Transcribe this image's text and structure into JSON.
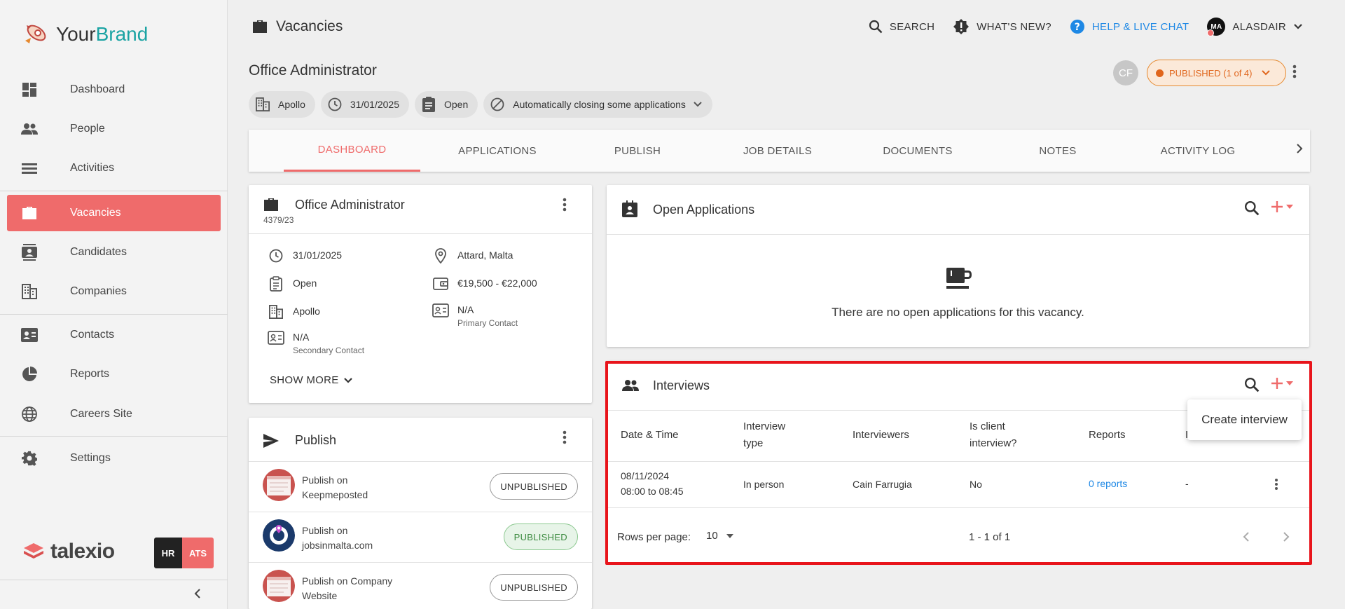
{
  "sidebar": {
    "brand": {
      "part1": "Your",
      "part2": "Brand"
    },
    "items": [
      {
        "label": "Dashboard",
        "icon": "dashboard-icon"
      },
      {
        "label": "People",
        "icon": "people-icon"
      },
      {
        "label": "Activities",
        "icon": "activities-icon"
      },
      {
        "label": "Vacancies",
        "icon": "briefcase-icon"
      },
      {
        "label": "Candidates",
        "icon": "candidates-icon"
      },
      {
        "label": "Companies",
        "icon": "building-icon"
      },
      {
        "label": "Contacts",
        "icon": "contact-card-icon"
      },
      {
        "label": "Reports",
        "icon": "pie-chart-icon"
      },
      {
        "label": "Careers Site",
        "icon": "globe-icon"
      },
      {
        "label": "Settings",
        "icon": "gear-icon"
      }
    ],
    "footer": {
      "logo_text": "talexio",
      "hr": "HR",
      "ats": "ATS"
    }
  },
  "header": {
    "section": "Vacancies",
    "search": "SEARCH",
    "whats_new": "WHAT'S NEW?",
    "help": "HELP & LIVE CHAT",
    "user_initials": "MA",
    "user_name": "ALASDAIR"
  },
  "vacancy": {
    "title": "Office Administrator",
    "chips": [
      "Apollo",
      "31/01/2025",
      "Open",
      "Automatically closing some applications"
    ],
    "cf": "CF",
    "status": "PUBLISHED (1 of 4)"
  },
  "tabs": [
    "DASHBOARD",
    "APPLICATIONS",
    "PUBLISH",
    "JOB DETAILS",
    "DOCUMENTS",
    "NOTES",
    "ACTIVITY LOG"
  ],
  "details_card": {
    "title": "Office Administrator",
    "ref": "4379/23",
    "date": "31/01/2025",
    "location": "Attard, Malta",
    "status": "Open",
    "salary": "€19,500 - €22,000",
    "company": "Apollo",
    "primary_value": "N/A",
    "primary_label": "Primary Contact",
    "secondary_value": "N/A",
    "secondary_label": "Secondary Contact",
    "show_more": "SHOW MORE"
  },
  "publish_card": {
    "title": "Publish",
    "rows": [
      {
        "line1": "Publish on",
        "line2": "Keepmeposted",
        "status": "UNPUBLISHED"
      },
      {
        "line1": "Publish on",
        "line2": "jobsinmalta.com",
        "status": "PUBLISHED"
      },
      {
        "line1": "Publish on Company",
        "line2": "Website",
        "status": "UNPUBLISHED"
      }
    ]
  },
  "open_applications": {
    "title": "Open Applications",
    "empty": "There are no open applications for this vacancy."
  },
  "interviews": {
    "title": "Interviews",
    "headers": {
      "date": "Date & Time",
      "type1": "Interview",
      "type2": "type",
      "interviewers": "Interviewers",
      "client1": "Is client",
      "client2": "interview?",
      "reports": "Reports",
      "extra": "I"
    },
    "row": {
      "date": "08/11/2024",
      "time": "08:00 to 08:45",
      "type": "In person",
      "interviewers": "Cain Farrugia",
      "client": "No",
      "reports": "0 reports",
      "extra": "-"
    },
    "rows_per_page_label": "Rows per page:",
    "rows_per_page": "10",
    "range": "1 - 1 of 1",
    "dropdown_item": "Create interview"
  },
  "colors": {
    "accent": "#ef6b6b",
    "brand_teal": "#1aa3a3",
    "link": "#1e88e5",
    "published_orange": "#e0661d",
    "highlight": "#e8141b"
  }
}
